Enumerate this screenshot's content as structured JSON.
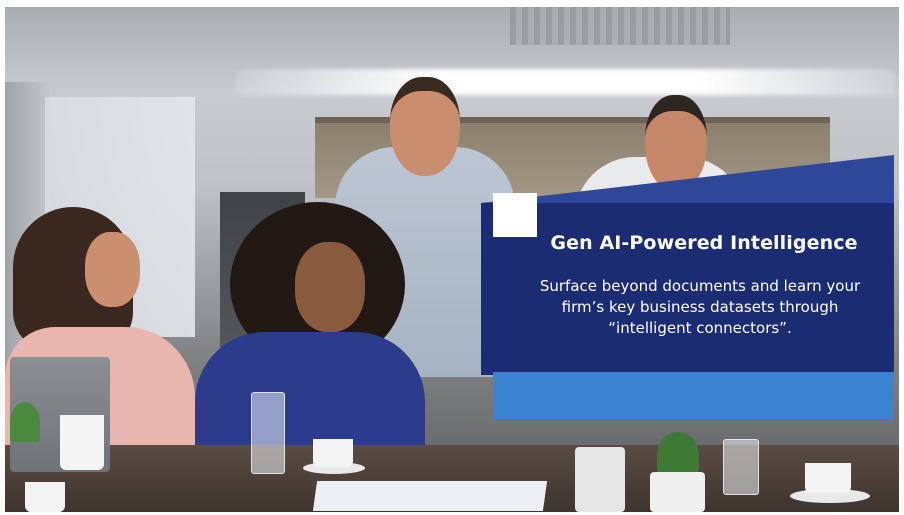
{
  "overlay": {
    "title": "Gen AI-Powered Intelligence",
    "description_lines": [
      "Surface beyond documents and learn your",
      "firm’s key business datasets through",
      "“intelligent connectors”."
    ]
  },
  "colors": {
    "panel": "#1c2c72",
    "panel_bevel": "#2f4799",
    "accent_bar": "#3b82d0",
    "accent_square": "#ffffff",
    "text": "#ffffff"
  }
}
